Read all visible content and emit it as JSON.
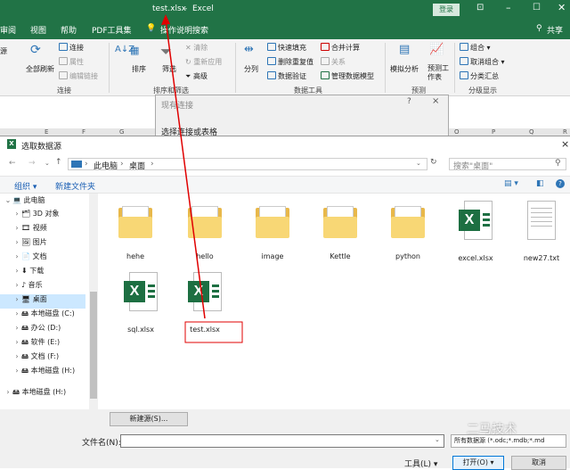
{
  "title": {
    "file": "test.xlsx",
    "sep": "-",
    "app": "Excel",
    "login": "登录"
  },
  "tabs": [
    "审阅",
    "视图",
    "帮助",
    "PDF工具集",
    "操作说明搜索"
  ],
  "share": "共享",
  "ribbon": {
    "left": [
      "源",
      "全部刷新"
    ],
    "conn": [
      "连接",
      "属性",
      "编辑链接"
    ],
    "conn_group": "连接",
    "sort": [
      "排序",
      "筛选"
    ],
    "filter": [
      "清除",
      "重新应用",
      "高级"
    ],
    "sort_group": "排序和筛选",
    "tools": [
      "分列",
      "快速填充",
      "删除重复值",
      "数据验证",
      "合并计算",
      "关系",
      "管理数据模型"
    ],
    "tools_group": "数据工具",
    "forecast": [
      "模拟分析",
      "预测工作表"
    ],
    "forecast_group": "预测",
    "outline": [
      "组合",
      "取消组合",
      "分类汇总"
    ],
    "outline_group": "分级显示"
  },
  "cols": [
    "E",
    "F",
    "G",
    "H",
    "I",
    "J",
    "K",
    "L",
    "M",
    "N",
    "O",
    "P",
    "Q",
    "R"
  ],
  "bgdlg": {
    "title": "现有连接",
    "question": "?",
    "close": "×",
    "text": "选择连接或表格"
  },
  "dialog": {
    "title": "选取数据源",
    "close": "×",
    "breadcrumb": [
      "此电脑",
      "桌面"
    ],
    "search_placeholder": "搜索\"桌面\"",
    "organize": "组织",
    "new_folder": "新建文件夹",
    "help": "?",
    "nav": [
      {
        "label": "此电脑",
        "indent": 0
      },
      {
        "label": "3D 对象",
        "indent": 1
      },
      {
        "label": "视频",
        "indent": 1
      },
      {
        "label": "图片",
        "indent": 1
      },
      {
        "label": "文档",
        "indent": 1
      },
      {
        "label": "下载",
        "indent": 1
      },
      {
        "label": "音乐",
        "indent": 1
      },
      {
        "label": "桌面",
        "indent": 1
      },
      {
        "label": "本地磁盘 (C:)",
        "indent": 1
      },
      {
        "label": "办公 (D:)",
        "indent": 1
      },
      {
        "label": "软件 (E:)",
        "indent": 1
      },
      {
        "label": "文档 (F:)",
        "indent": 1
      },
      {
        "label": "本地磁盘 (H:)",
        "indent": 1
      },
      {
        "label": "本地磁盘 (H:)",
        "indent": 0
      }
    ],
    "files": [
      {
        "name": "hehe",
        "kind": "folder"
      },
      {
        "name": "hello",
        "kind": "folder"
      },
      {
        "name": "image",
        "kind": "folder"
      },
      {
        "name": "Kettle",
        "kind": "folder"
      },
      {
        "name": "python",
        "kind": "folder"
      },
      {
        "name": "excel.xlsx",
        "kind": "xlsx"
      },
      {
        "name": "new27.txt",
        "kind": "txt"
      },
      {
        "name": "sql.xlsx",
        "kind": "xlsx"
      },
      {
        "name": "test.xlsx",
        "kind": "xlsx"
      }
    ],
    "new_source": "新建源(S)...",
    "filename_label": "文件名(N):",
    "filename_value": "",
    "filetype": "所有数据源 (*.odc;*.mdb;*.md",
    "tools": "工具(L)",
    "open": "打开(O)",
    "cancel": "取消"
  },
  "watermark": "二马技术",
  "accent": "#217346",
  "annotation_color": "#e00000"
}
